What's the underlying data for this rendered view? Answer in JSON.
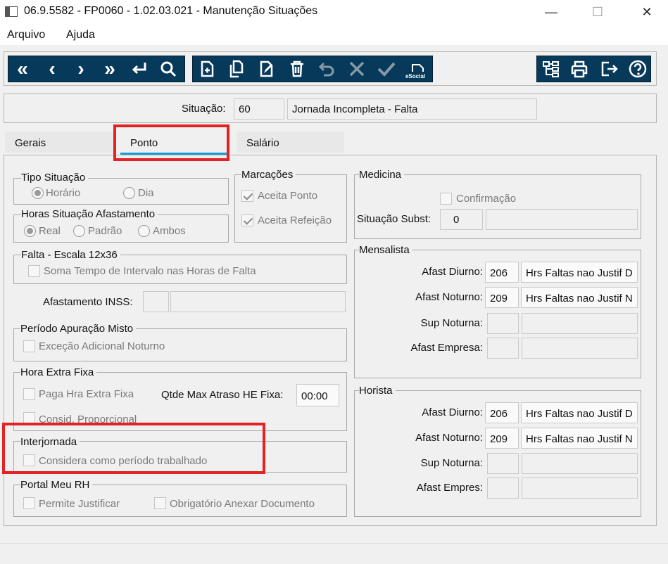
{
  "window": {
    "title": "06.9.5582 - FP0060 - 1.02.03.021 - Manutenção Situações",
    "minimize": "—",
    "maximize": "☐",
    "close": "✕"
  },
  "menu": {
    "items": [
      "Arquivo",
      "Ajuda"
    ]
  },
  "toolbar": {
    "esocial_label": "eSocial",
    "icons": [
      "first-icon",
      "previous-icon",
      "next-icon",
      "last-icon",
      "enter-icon",
      "search-icon",
      "new-icon",
      "copy-icon",
      "edit-icon",
      "delete-icon",
      "undo-icon",
      "cancel-icon",
      "confirm-icon",
      "esocial-icon",
      "tree-icon",
      "print-icon",
      "exit-icon",
      "help-icon"
    ]
  },
  "header": {
    "situacao_label": "Situação:",
    "situacao_code": "60",
    "situacao_desc": "Jornada Incompleta - Falta"
  },
  "tabs": [
    "Gerais",
    "Ponto",
    "Salário"
  ],
  "active_tab": "Ponto",
  "tipo_situacao": {
    "title": "Tipo Situação",
    "options": [
      "Horário",
      "Dia"
    ],
    "selected": "Horário"
  },
  "horas_afastamento": {
    "title": "Horas Situação Afastamento",
    "options": [
      "Real",
      "Padrão",
      "Ambos"
    ],
    "selected": "Real"
  },
  "marcacoes": {
    "title": "Marcações",
    "aceita_ponto": "Aceita Ponto",
    "aceita_refeicao": "Aceita Refeição"
  },
  "medicina": {
    "title": "Medicina",
    "confirmacao": "Confirmação",
    "situacao_subst_label": "Situação Subst:",
    "situacao_subst_value": "0"
  },
  "falta_escala": {
    "title": "Falta - Escala 12x36",
    "soma_tempo": "Soma Tempo de Intervalo nas Horas de Falta"
  },
  "afastamento_inss": {
    "label": "Afastamento INSS:"
  },
  "periodo_misto": {
    "title": "Período Apuração Misto",
    "excecao": "Exceção Adicional Noturno"
  },
  "hora_extra": {
    "title": "Hora Extra Fixa",
    "paga_hra": "Paga Hra Extra Fixa",
    "qtde_label": "Qtde Max Atraso HE Fixa:",
    "qtde_value": "00:00",
    "consid": "Consid. Proporcional"
  },
  "interjornada": {
    "title": "Interjornada",
    "considera": "Considera como período trabalhado"
  },
  "portal": {
    "title": "Portal Meu RH",
    "permite": "Permite Justificar",
    "obrigatorio": "Obrigatório Anexar Documento"
  },
  "mensalista": {
    "title": "Mensalista",
    "rows": [
      {
        "label": "Afast Diurno:",
        "code": "206",
        "desc": "Hrs Faltas nao Justif D"
      },
      {
        "label": "Afast Noturno:",
        "code": "209",
        "desc": "Hrs Faltas nao Justif N"
      },
      {
        "label": "Sup Noturna:",
        "code": "",
        "desc": ""
      },
      {
        "label": "Afast Empresa:",
        "code": "",
        "desc": ""
      }
    ]
  },
  "horista": {
    "title": "Horista",
    "rows": [
      {
        "label": "Afast Diurno:",
        "code": "206",
        "desc": "Hrs Faltas nao Justif D"
      },
      {
        "label": "Afast Noturno:",
        "code": "209",
        "desc": "Hrs Faltas nao Justif N"
      },
      {
        "label": "Sup Noturna:",
        "code": "",
        "desc": ""
      },
      {
        "label": "Afast Empres:",
        "code": "",
        "desc": ""
      }
    ]
  },
  "colors": {
    "toolbar": "#07395a",
    "tab_indicator": "#1a9bd7",
    "highlight": "#e32323"
  }
}
